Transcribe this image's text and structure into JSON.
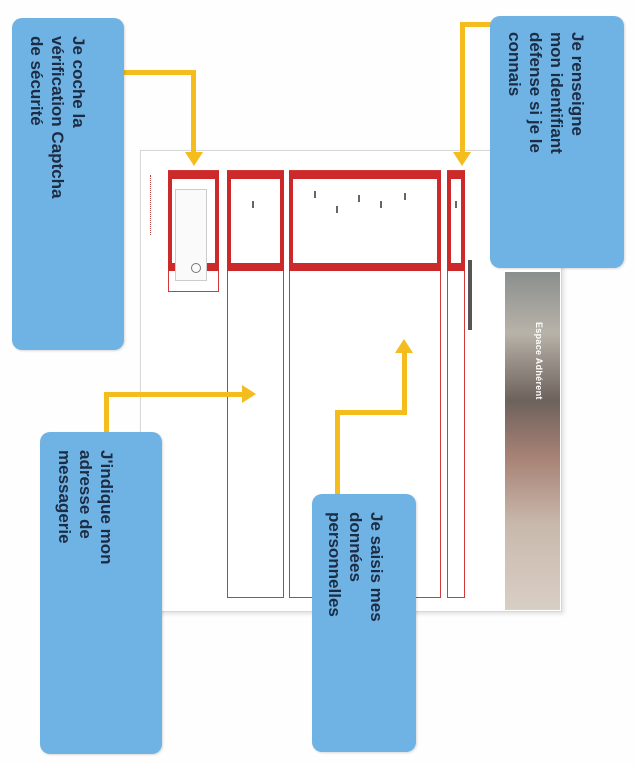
{
  "callouts": {
    "captcha": "Je coche la\nvérification Captcha\nde sécurité",
    "defense_id": "Je renseigne\nmon identifiant\ndéfense si je le\nconnais",
    "email": "J'indique mon\nadresse de\nmessagerie",
    "personal_data": "Je saisis mes\ndonnées\npersonnelles"
  },
  "form_screenshot": {
    "banner_title": "Espace Adhérent"
  },
  "colors": {
    "callout_fill": "#6fb3e4",
    "connector": "#f4bc1c",
    "section_border": "#d23a3a"
  }
}
